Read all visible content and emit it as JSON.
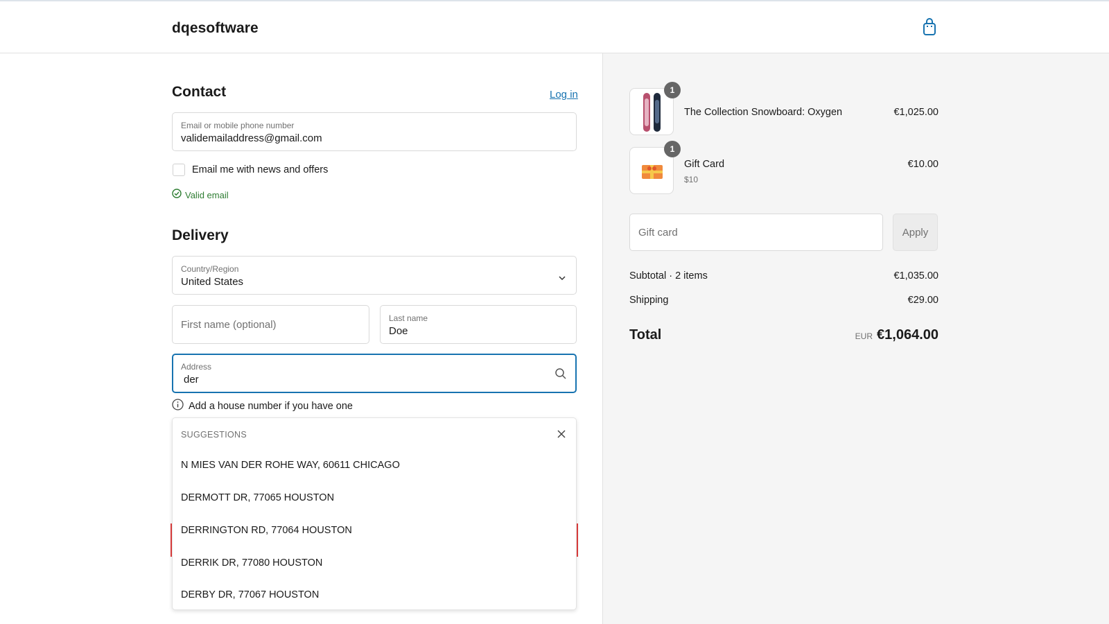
{
  "header": {
    "brand": "dqesoftware",
    "cart_icon": "shopping-bag-icon"
  },
  "contact": {
    "title": "Contact",
    "login_label": "Log in",
    "email_label": "Email or mobile phone number",
    "email_value": "validemailaddress@gmail.com",
    "newsletter_label": "Email me with news and offers",
    "valid_text": "Valid email"
  },
  "delivery": {
    "title": "Delivery",
    "country_label": "Country/Region",
    "country_value": "United States",
    "first_name_placeholder": "First name (optional)",
    "last_name_label": "Last name",
    "last_name_value": "Doe",
    "address_label": "Address",
    "address_value": "der",
    "house_hint": "Add a house number if you have one",
    "suggestions_title": "SUGGESTIONS",
    "suggestions": [
      "N MIES VAN DER ROHE WAY, 60611 CHICAGO",
      "DERMOTT DR, 77065 HOUSTON",
      "DERRINGTON RD, 77064 HOUSTON",
      "DERRIK DR, 77080 HOUSTON",
      "DERBY DR, 77067 HOUSTON"
    ]
  },
  "summary": {
    "items": [
      {
        "name": "The Collection Snowboard: Oxygen",
        "variant": "",
        "price": "€1,025.00",
        "qty": "1"
      },
      {
        "name": "Gift Card",
        "variant": "$10",
        "price": "€10.00",
        "qty": "1"
      }
    ],
    "gift_card_placeholder": "Gift card",
    "apply_label": "Apply",
    "subtotal_label": "Subtotal · 2 items",
    "subtotal_value": "€1,035.00",
    "shipping_label": "Shipping",
    "shipping_value": "€29.00",
    "total_label": "Total",
    "total_currency": "EUR",
    "total_value": "€1,064.00"
  },
  "colors": {
    "accent": "#1773b0",
    "valid": "#2e7d32",
    "error": "#e03c3c",
    "panel_bg": "#f5f5f5"
  }
}
